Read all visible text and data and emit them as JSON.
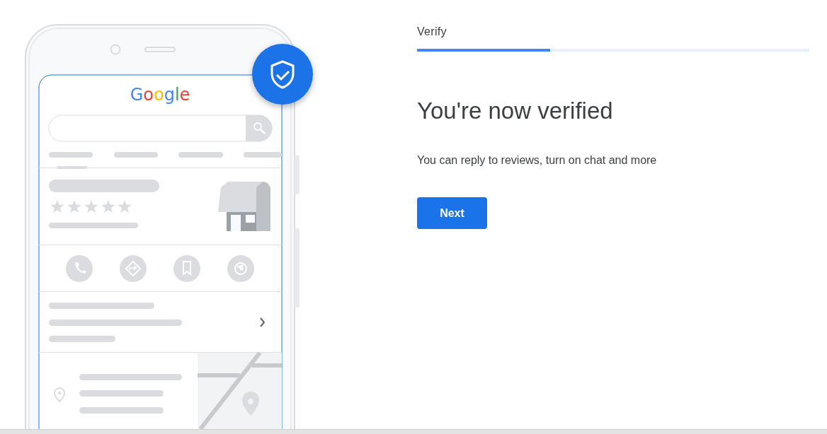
{
  "illustration": {
    "logo": "Google"
  },
  "step": {
    "label": "Verify",
    "level": 0.34
  },
  "heading": "You're now verified",
  "body": "You can reply to reviews, turn on chat and more",
  "buttons": [
    {
      "label": "Next"
    }
  ]
}
